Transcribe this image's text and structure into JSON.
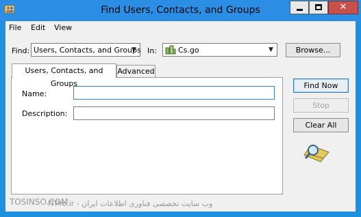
{
  "window": {
    "title": "Find Users, Contacts, and Groups",
    "close_glyph": "✕"
  },
  "menu": [
    {
      "label": "File"
    },
    {
      "label": "Edit"
    },
    {
      "label": "View"
    }
  ],
  "find": {
    "find_label": "Find:",
    "find_value": "Users, Contacts, and Groups",
    "in_label": "In:",
    "in_value": "Cs.go",
    "browse_label": "Browse..."
  },
  "tabs": [
    {
      "label": "Users, Contacts, and Groups",
      "active": true
    },
    {
      "label": "Advanced",
      "active": false
    }
  ],
  "fields": {
    "name_label": "Name:",
    "name_value": "",
    "description_label": "Description:",
    "description_value": ""
  },
  "actions": {
    "find_now": "Find Now",
    "stop": "Stop",
    "clear_all": "Clear All"
  },
  "watermark": {
    "left": "TOSINSO.COM",
    "right": "ITPro.ir - وب سایت تخصصی فناوری اطلاعات ایران"
  },
  "colors": {
    "titlebar": "#2b8ee4",
    "close_button": "#c7504b",
    "dialog_bg": "#f0f0f0"
  }
}
